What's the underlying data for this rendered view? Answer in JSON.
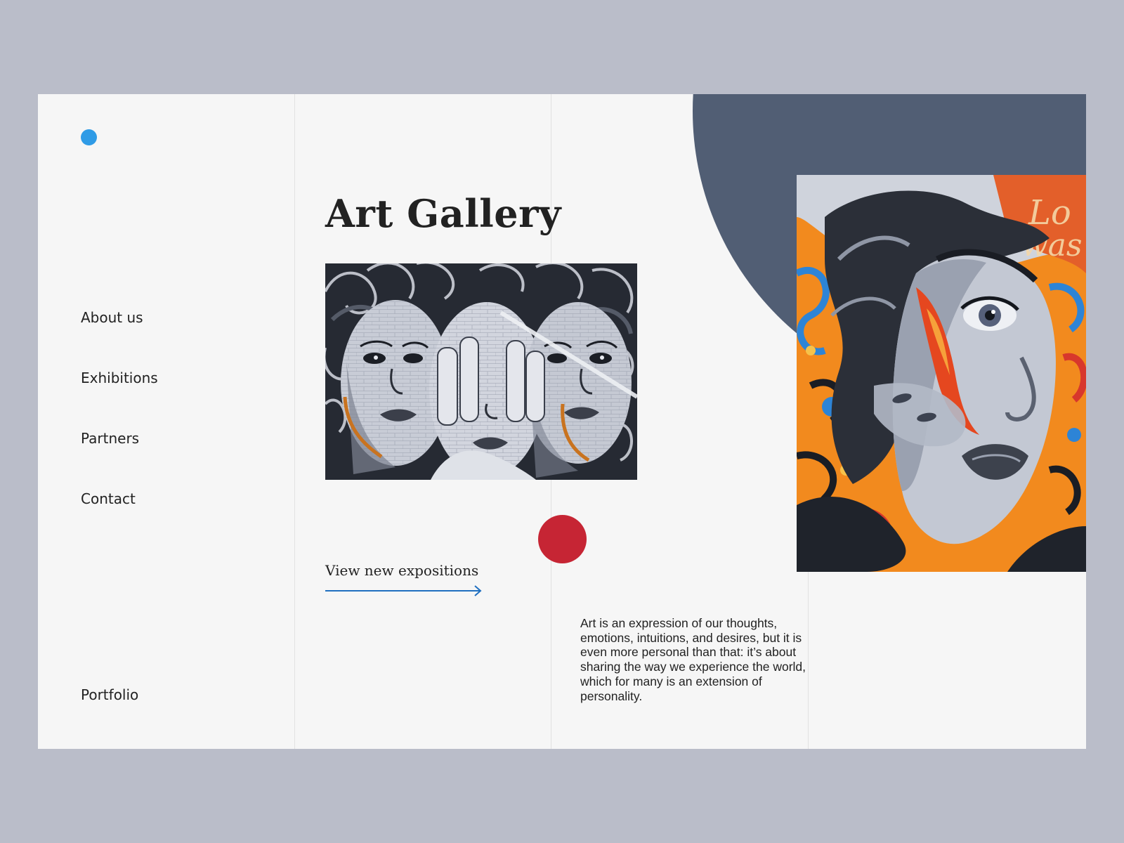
{
  "nav": {
    "items": [
      {
        "label": "About us"
      },
      {
        "label": "Exhibitions"
      },
      {
        "label": "Partners"
      },
      {
        "label": "Contact"
      }
    ],
    "portfolio_label": "Portfolio"
  },
  "hero": {
    "title": "Art Gallery",
    "cta_label": "View new expositions",
    "description": "Art is an expression of our thoughts, emotions, intuitions, and desires, but it is even more personal than that: it’s about sharing the way we experience the world, which for many is an extension of personality."
  },
  "images": {
    "small": "black-and-white street mural of three faces with hands over eyes",
    "large": "colorful street mural of a woman's face with blue, orange and red swirls"
  },
  "colors": {
    "page_background": "#babdc9",
    "card_background": "#f6f6f6",
    "logo_dot": "#2f9be6",
    "accent_red": "#c62534",
    "navy_shape": "#515e74",
    "link_arrow": "#1f6fc0",
    "text": "#222222"
  },
  "icons": {
    "logo": "logo-dot",
    "cta": "arrow-right-icon"
  }
}
